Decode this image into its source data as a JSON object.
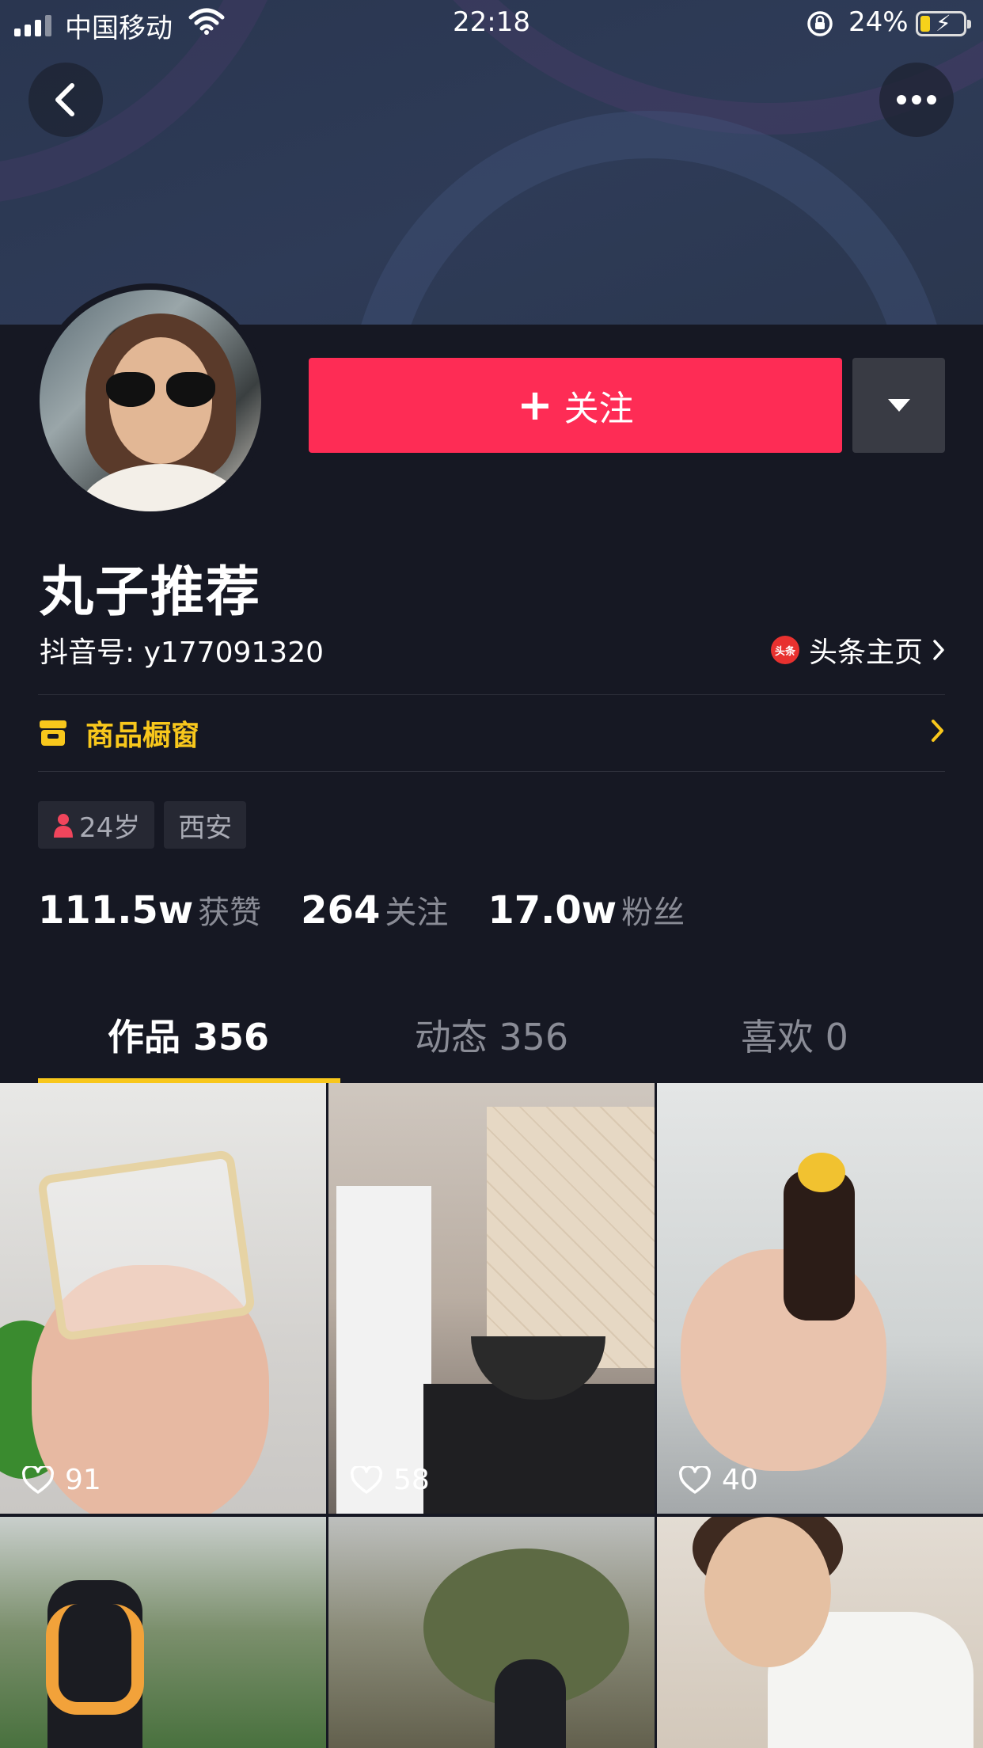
{
  "status_bar": {
    "carrier": "中国移动",
    "time": "22:18",
    "battery_percent": "24%",
    "battery_level": 0.24,
    "icons": [
      "signal-icon",
      "wifi-icon",
      "rotation-lock-icon",
      "battery-charging-icon"
    ]
  },
  "header": {
    "back_icon": "chevron-left-icon",
    "more_icon": "more-dots-icon"
  },
  "profile": {
    "follow_label": "关注",
    "follow_icon": "plus-icon",
    "dropdown_icon": "caret-down-icon",
    "nickname": "丸子推荐",
    "douyin_id": "抖音号: y177091320",
    "toutiao_badge": "头条",
    "toutiao_label": "头条主页",
    "shop_label": "商品橱窗",
    "tags": [
      {
        "icon": "female-icon",
        "label": "24岁"
      },
      {
        "label": "西安"
      }
    ],
    "stats": [
      {
        "value": "111.5w",
        "label": "获赞"
      },
      {
        "value": "264",
        "label": "关注"
      },
      {
        "value": "17.0w",
        "label": "粉丝"
      }
    ]
  },
  "tabs": [
    {
      "label": "作品 356",
      "active": true
    },
    {
      "label": "动态 356",
      "active": false
    },
    {
      "label": "喜欢 0",
      "active": false
    }
  ],
  "videos": [
    {
      "likes": "91"
    },
    {
      "likes": "58"
    },
    {
      "likes": "40"
    },
    {
      "likes": ""
    },
    {
      "likes": ""
    },
    {
      "likes": ""
    }
  ],
  "colors": {
    "background": "#161823",
    "follow_button": "#fe2c55",
    "accent_yellow": "#f8c71c",
    "secondary_text": "#8a8c96"
  }
}
